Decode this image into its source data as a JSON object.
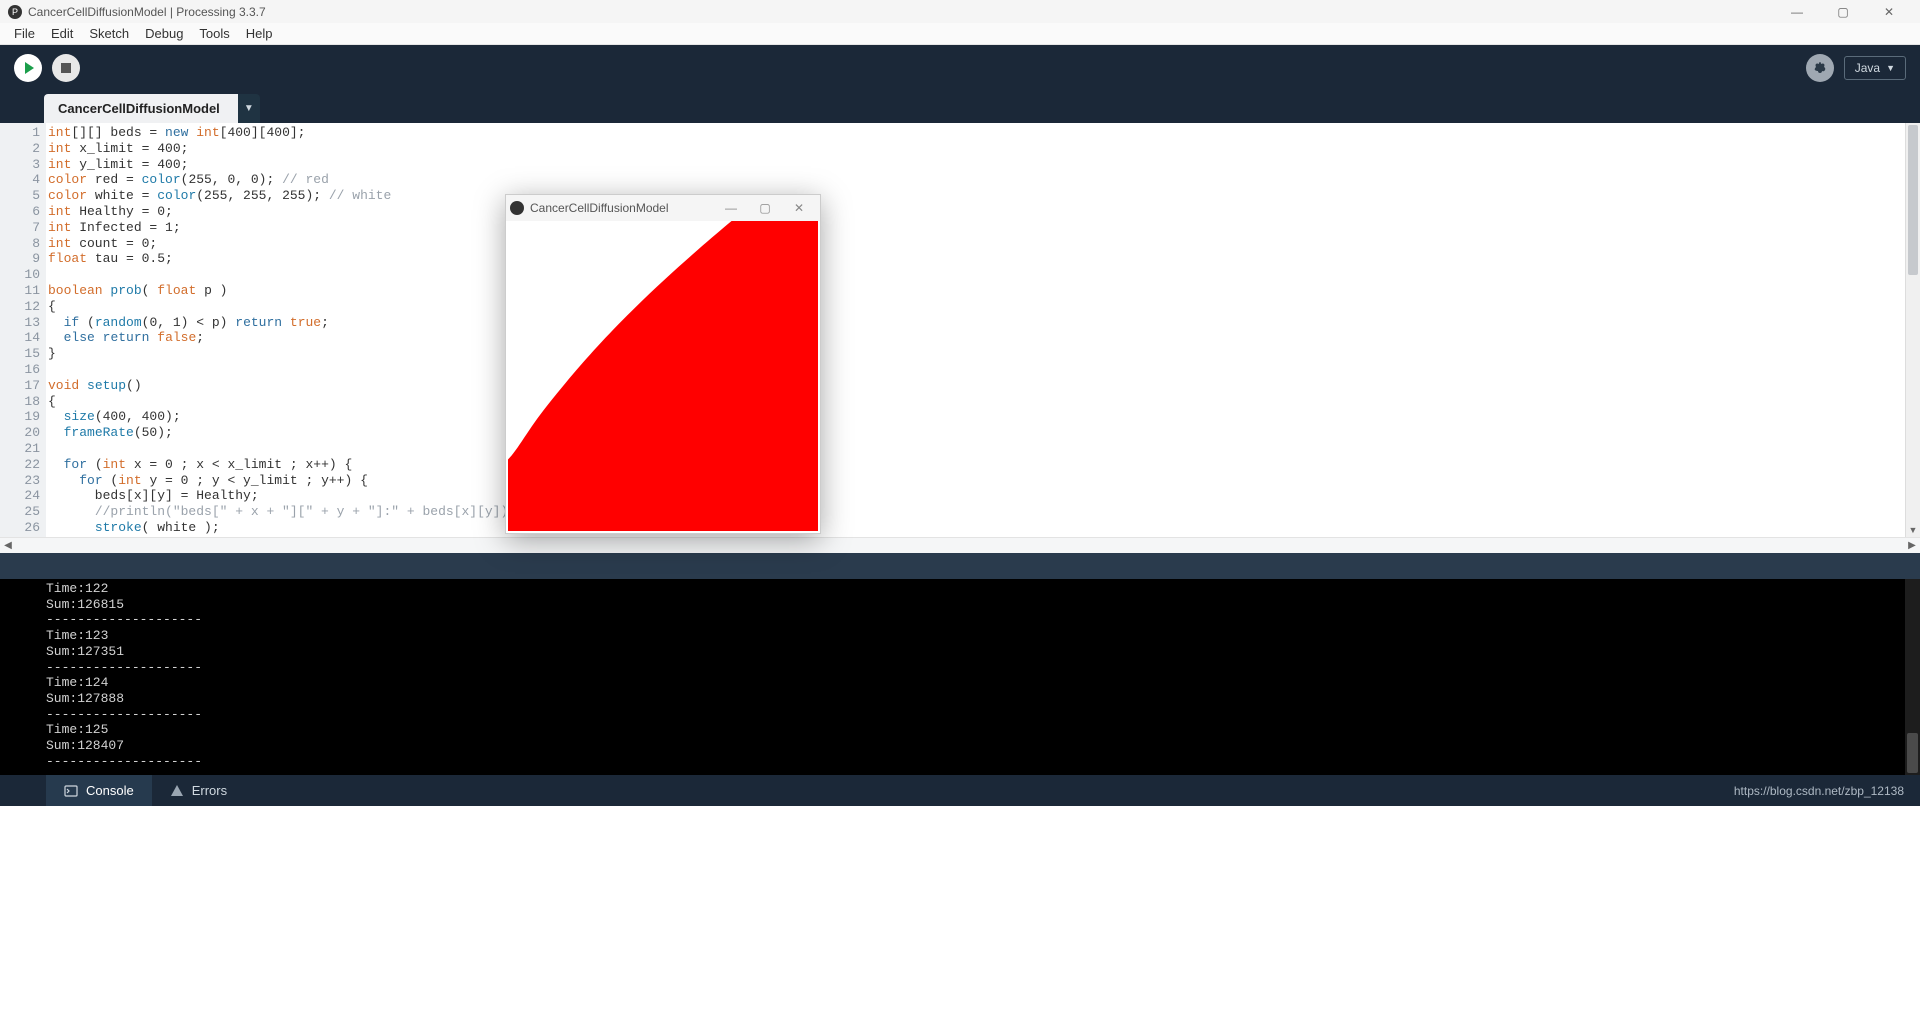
{
  "window": {
    "title": "CancerCellDiffusionModel | Processing 3.3.7",
    "min": "—",
    "max": "▢",
    "close": "✕"
  },
  "menu": {
    "items": [
      "File",
      "Edit",
      "Sketch",
      "Debug",
      "Tools",
      "Help"
    ]
  },
  "toolbar": {
    "mode_badge": "⌘",
    "lang_label": "Java",
    "lang_caret": "▼"
  },
  "tabs": {
    "active": "CancerCellDiffusionModel",
    "dropdown": "▼"
  },
  "code": {
    "lines": [
      {
        "n": "1",
        "html": "<span class='tok-type'>int</span>[][] beds = <span class='tok-kw'>new</span> <span class='tok-type'>int</span>[400][400];"
      },
      {
        "n": "2",
        "html": "<span class='tok-type'>int</span> x_limit = 400;"
      },
      {
        "n": "3",
        "html": "<span class='tok-type'>int</span> y_limit = 400;"
      },
      {
        "n": "4",
        "html": "<span class='tok-type'>color</span> red = <span class='tok-fn'>color</span>(255, 0, 0); <span class='tok-comment'>// red</span>"
      },
      {
        "n": "5",
        "html": "<span class='tok-type'>color</span> white = <span class='tok-fn'>color</span>(255, 255, 255); <span class='tok-comment'>// white</span>"
      },
      {
        "n": "6",
        "html": "<span class='tok-type'>int</span> Healthy = 0;"
      },
      {
        "n": "7",
        "html": "<span class='tok-type'>int</span> Infected = 1;"
      },
      {
        "n": "8",
        "html": "<span class='tok-type'>int</span> count = 0;"
      },
      {
        "n": "9",
        "html": "<span class='tok-type'>float</span> tau = 0.5;"
      },
      {
        "n": "10",
        "html": ""
      },
      {
        "n": "11",
        "html": "<span class='tok-type'>boolean</span> <span class='tok-fn'>prob</span>( <span class='tok-type'>float</span> p )"
      },
      {
        "n": "12",
        "html": "{"
      },
      {
        "n": "13",
        "html": "  <span class='tok-kw'>if</span> (<span class='tok-fn'>random</span>(0, 1) &lt; p) <span class='tok-kw'>return</span> <span class='tok-bool'>true</span>;"
      },
      {
        "n": "14",
        "html": "  <span class='tok-kw'>else</span> <span class='tok-kw'>return</span> <span class='tok-bool'>false</span>;"
      },
      {
        "n": "15",
        "html": "}"
      },
      {
        "n": "16",
        "html": ""
      },
      {
        "n": "17",
        "html": "<span class='tok-type'>void</span> <span class='tok-fn'>setup</span>()"
      },
      {
        "n": "18",
        "html": "{"
      },
      {
        "n": "19",
        "html": "  <span class='tok-fn'>size</span>(400, 400);"
      },
      {
        "n": "20",
        "html": "  <span class='tok-fn'>frameRate</span>(50);"
      },
      {
        "n": "21",
        "html": ""
      },
      {
        "n": "22",
        "html": "  <span class='tok-kw'>for</span> (<span class='tok-type'>int</span> x = 0 ; x &lt; x_limit ; x++) {"
      },
      {
        "n": "23",
        "html": "    <span class='tok-kw'>for</span> (<span class='tok-type'>int</span> y = 0 ; y &lt; y_limit ; y++) {"
      },
      {
        "n": "24",
        "html": "      beds[x][y] = Healthy;"
      },
      {
        "n": "25",
        "html": "      <span class='tok-comment'>//println(\"beds[\" + x + \"][\" + y + \"]:\" + beds[x][y]);</span>"
      },
      {
        "n": "26",
        "html": "      <span class='tok-fn'>stroke</span>( white );"
      }
    ]
  },
  "console": {
    "lines": [
      "Time:122",
      "Sum:126815",
      "--------------------",
      "Time:123",
      "Sum:127351",
      "--------------------",
      "Time:124",
      "Sum:127888",
      "--------------------",
      "Time:125",
      "Sum:128407",
      "--------------------"
    ]
  },
  "bottombar": {
    "console_label": "Console",
    "errors_label": "Errors",
    "url": "https://blog.csdn.net/zbp_12138"
  },
  "sketch_window": {
    "title": "CancerCellDiffusionModel",
    "min": "—",
    "max": "▢",
    "close": "✕"
  }
}
